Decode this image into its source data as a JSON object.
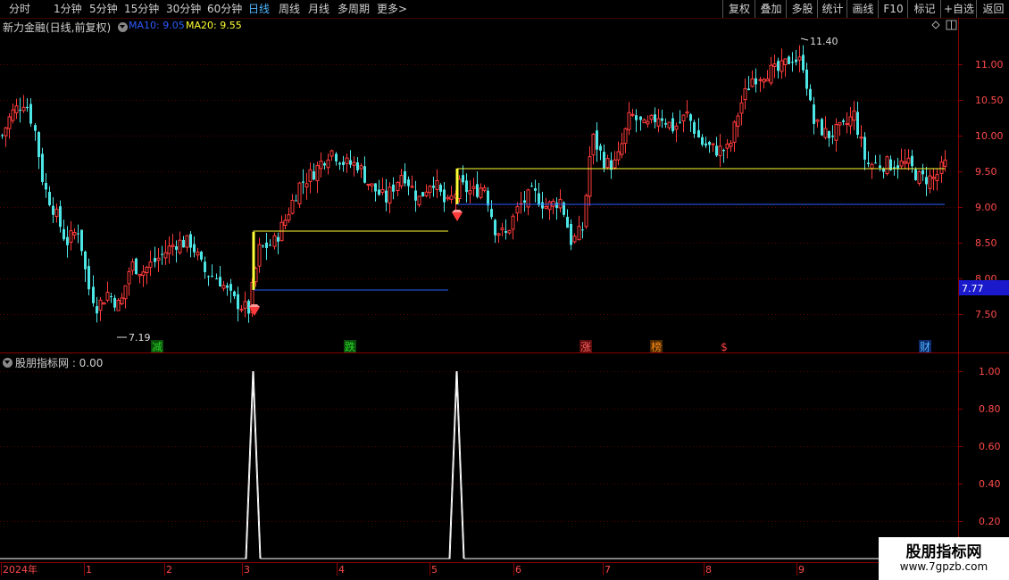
{
  "toolbar": {
    "periods": [
      "分时",
      "1分钟",
      "5分钟",
      "15分钟",
      "30分钟",
      "60分钟",
      "日线",
      "周线",
      "月线",
      "多周期",
      "更多"
    ],
    "more_arrow": ">",
    "active_period": "日线",
    "right_buttons": [
      "复权",
      "叠加",
      "多股",
      "统计",
      "画线",
      "F10",
      "标记",
      "+自选",
      "返回"
    ]
  },
  "main_chart": {
    "title": "新力金融(日线,前复权)",
    "ma10_label": "MA10: 9.05",
    "ma20_label": "MA20: 9.55",
    "ma10_color": "#2a5cff",
    "ma20_color": "#ffff33",
    "up_color": "#ff3b3b",
    "down_color": "#4de6e6",
    "high_label": "11.40",
    "low_label": "7.19",
    "current_price": "7.77",
    "current_price_bg": "#1a1acc",
    "y_ticks": [
      "11.00",
      "10.50",
      "10.00",
      "9.50",
      "9.00",
      "8.50",
      "8.00",
      "7.50"
    ],
    "events": [
      {
        "text": "减",
        "color": "#26d426",
        "bg": "#0b4d0b"
      },
      {
        "text": "跌",
        "color": "#26d426",
        "bg": "#0b4d0b"
      },
      {
        "text": "涨",
        "color": "#ff6060",
        "bg": "#5a0c0c"
      },
      {
        "text": "榜",
        "color": "#ff8c1a",
        "bg": "#4d2a00"
      },
      {
        "text": "$",
        "color": "#ff4040",
        "bg": "#000000"
      },
      {
        "text": "财",
        "color": "#4fb6ff",
        "bg": "#0b2a6b"
      }
    ]
  },
  "indicator": {
    "title": "股朋指标网 : 0.00",
    "y_ticks": [
      "1.00",
      "0.80",
      "0.60",
      "0.40",
      "0.20"
    ]
  },
  "x_axis": {
    "labels": [
      "2024年",
      "1",
      "2",
      "3",
      "4",
      "5",
      "6",
      "7",
      "8",
      "9"
    ]
  },
  "watermark": {
    "line1": "股朋指标网",
    "line2": "www.7gpzb.com"
  }
}
